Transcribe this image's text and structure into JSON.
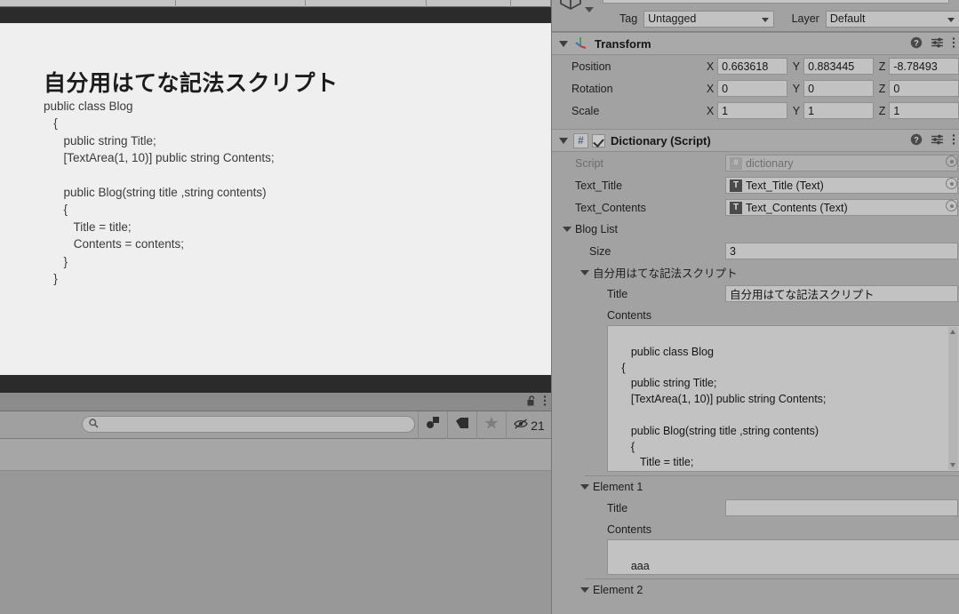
{
  "game_view": {
    "page_title": "自分用はてな記法スクリプト",
    "code": "public class Blog\n   {\n      public string Title;\n      [TextArea(1, 10)] public string Contents;\n\n      public Blog(string title ,string contents)\n      {\n         Title = title;\n         Contents = contents;\n      }\n   }"
  },
  "project_panel": {
    "lock_icon": "unlocked-padlock-icon",
    "menu_icon": "kebab-menu-icon",
    "search": {
      "value": "",
      "placeholder": "",
      "icon": "search-icon"
    },
    "filters": [
      {
        "name": "filter-by-type-button",
        "icon": "shapes-icon"
      },
      {
        "name": "filter-by-label-button",
        "icon": "tag-icon"
      },
      {
        "name": "filter-favorites-button",
        "icon": "star-icon"
      }
    ],
    "hidden_items": {
      "icon": "eye-off-icon",
      "count": "21"
    }
  },
  "inspector": {
    "object_icon": "prefab-cube-icon",
    "tag": {
      "label": "Tag",
      "value": "Untagged"
    },
    "layer": {
      "label": "Layer",
      "value": "Default"
    },
    "transform": {
      "title": "Transform",
      "icon": "transform-axis-icon",
      "help_icon": "help-icon",
      "preset_icon": "preset-icon",
      "menu_icon": "kebab-menu-icon",
      "rows": [
        {
          "label": "Position",
          "x": "0.663618",
          "y": "0.883445",
          "z": "-8.78493"
        },
        {
          "label": "Rotation",
          "x": "0",
          "y": "0",
          "z": "0"
        },
        {
          "label": "Scale",
          "x": "1",
          "y": "1",
          "z": "1"
        }
      ],
      "axis_labels": [
        "X",
        "Y",
        "Z"
      ]
    },
    "dictionary": {
      "title": "Dictionary (Script)",
      "script_badge": "#",
      "enabled": true,
      "help_icon": "help-icon",
      "preset_icon": "preset-icon",
      "menu_icon": "kebab-menu-icon",
      "fields": [
        {
          "label": "Script",
          "value": "dictionary",
          "readonly": true,
          "icon": "cs-script-icon"
        },
        {
          "label": "Text_Title",
          "value": "Text_Title (Text)",
          "readonly": false,
          "icon": "text-component-icon"
        },
        {
          "label": "Text_Contents",
          "value": "Text_Contents (Text)",
          "readonly": false,
          "icon": "text-component-icon"
        }
      ],
      "blog_list": {
        "label": "Blog List",
        "size_label": "Size",
        "size_value": "3",
        "elements": [
          {
            "header": "自分用はてな記法スクリプト",
            "title_label": "Title",
            "title_value": "自分用はてな記法スクリプト",
            "contents_label": "Contents",
            "contents_value": "public class Blog\n   {\n      public string Title;\n      [TextArea(1, 10)] public string Contents;\n\n      public Blog(string title ,string contents)\n      {\n         Title = title;\n         Contents = contents;"
          },
          {
            "header": "Element 1",
            "title_label": "Title",
            "title_value": "",
            "contents_label": "Contents",
            "contents_value": "aaa"
          },
          {
            "header": "Element 2",
            "title_label": "",
            "title_value": "",
            "contents_label": "",
            "contents_value": ""
          }
        ]
      }
    }
  },
  "colors": {
    "panel_bg": "#a2a2a2",
    "field_bg": "#c2c2c2",
    "game_bg": "#efefef",
    "dark_bar": "#2b2b2b"
  }
}
